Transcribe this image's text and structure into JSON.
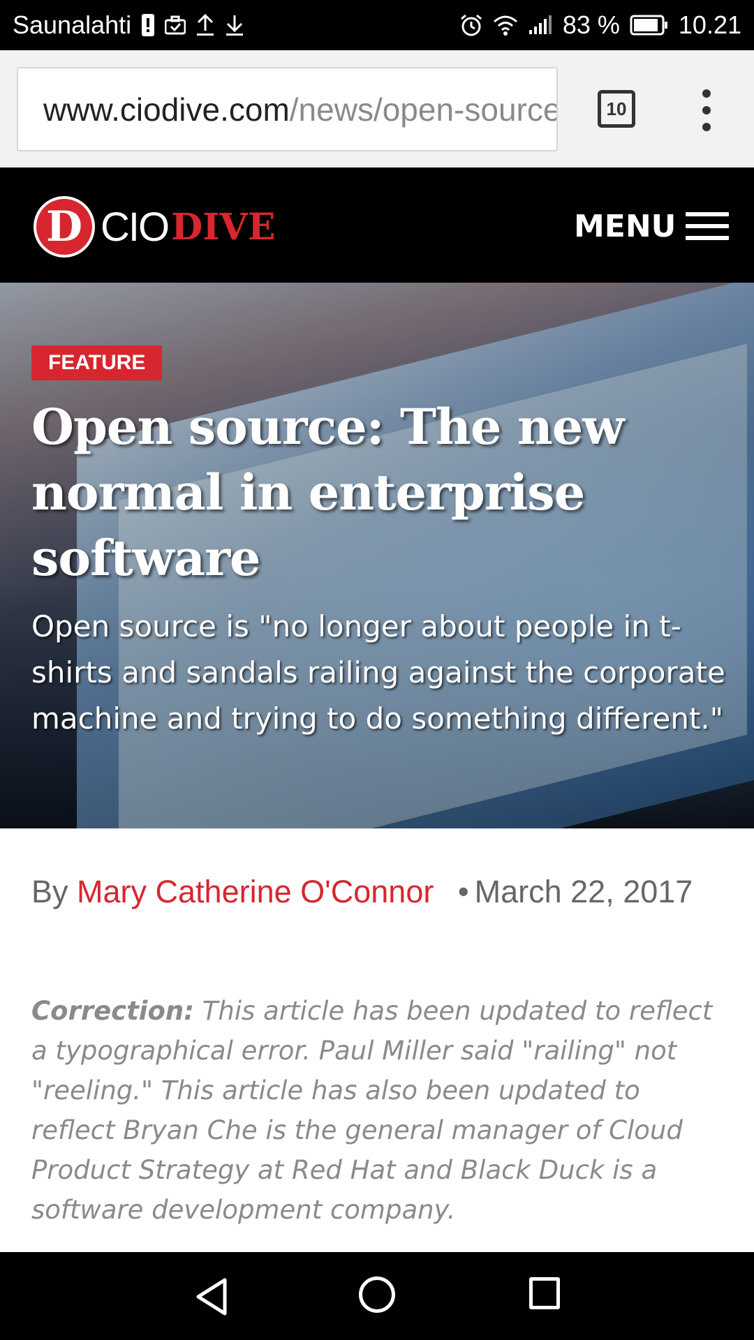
{
  "status_bar": {
    "carrier": "Saunalahti",
    "battery_percent": "83 %",
    "time": "10.21"
  },
  "browser": {
    "url_host": "www.ciodive.com",
    "url_path": "/news/open-source-the-new-normal-in-enterprise-software",
    "tab_count": "10"
  },
  "site": {
    "logo_cio": "CIO",
    "logo_dive": "DIVE",
    "logo_letter": "D",
    "menu_label": "MENU"
  },
  "article": {
    "badge": "FEATURE",
    "title": "Open source: The new normal in enterprise software",
    "dek": "Open source is \"no longer about people in t-shirts and sandals railing against the corporate machine and trying to do something different.\"",
    "by_label": "By",
    "author": "Mary Catherine O'Connor",
    "date": "March 22, 2017",
    "correction_label": "Correction:",
    "correction_text": " This article has been updated to reflect a typographical error. Paul Miller said \"railing\" not \"reeling.\" This article has also been updated to reflect Bryan Che is the general manager of Cloud Product Strategy at Red Hat and Black Duck is a software development company."
  },
  "colors": {
    "accent": "#d7262f",
    "header_bg": "#000000"
  },
  "icons": [
    "sim-alert-icon",
    "briefcase-icon",
    "upload-icon",
    "download-icon",
    "alarm-icon",
    "wifi-icon",
    "signal-icon",
    "battery-icon",
    "tabs-icon",
    "overflow-menu-icon",
    "hamburger-icon",
    "back-icon",
    "home-icon",
    "recents-icon"
  ]
}
